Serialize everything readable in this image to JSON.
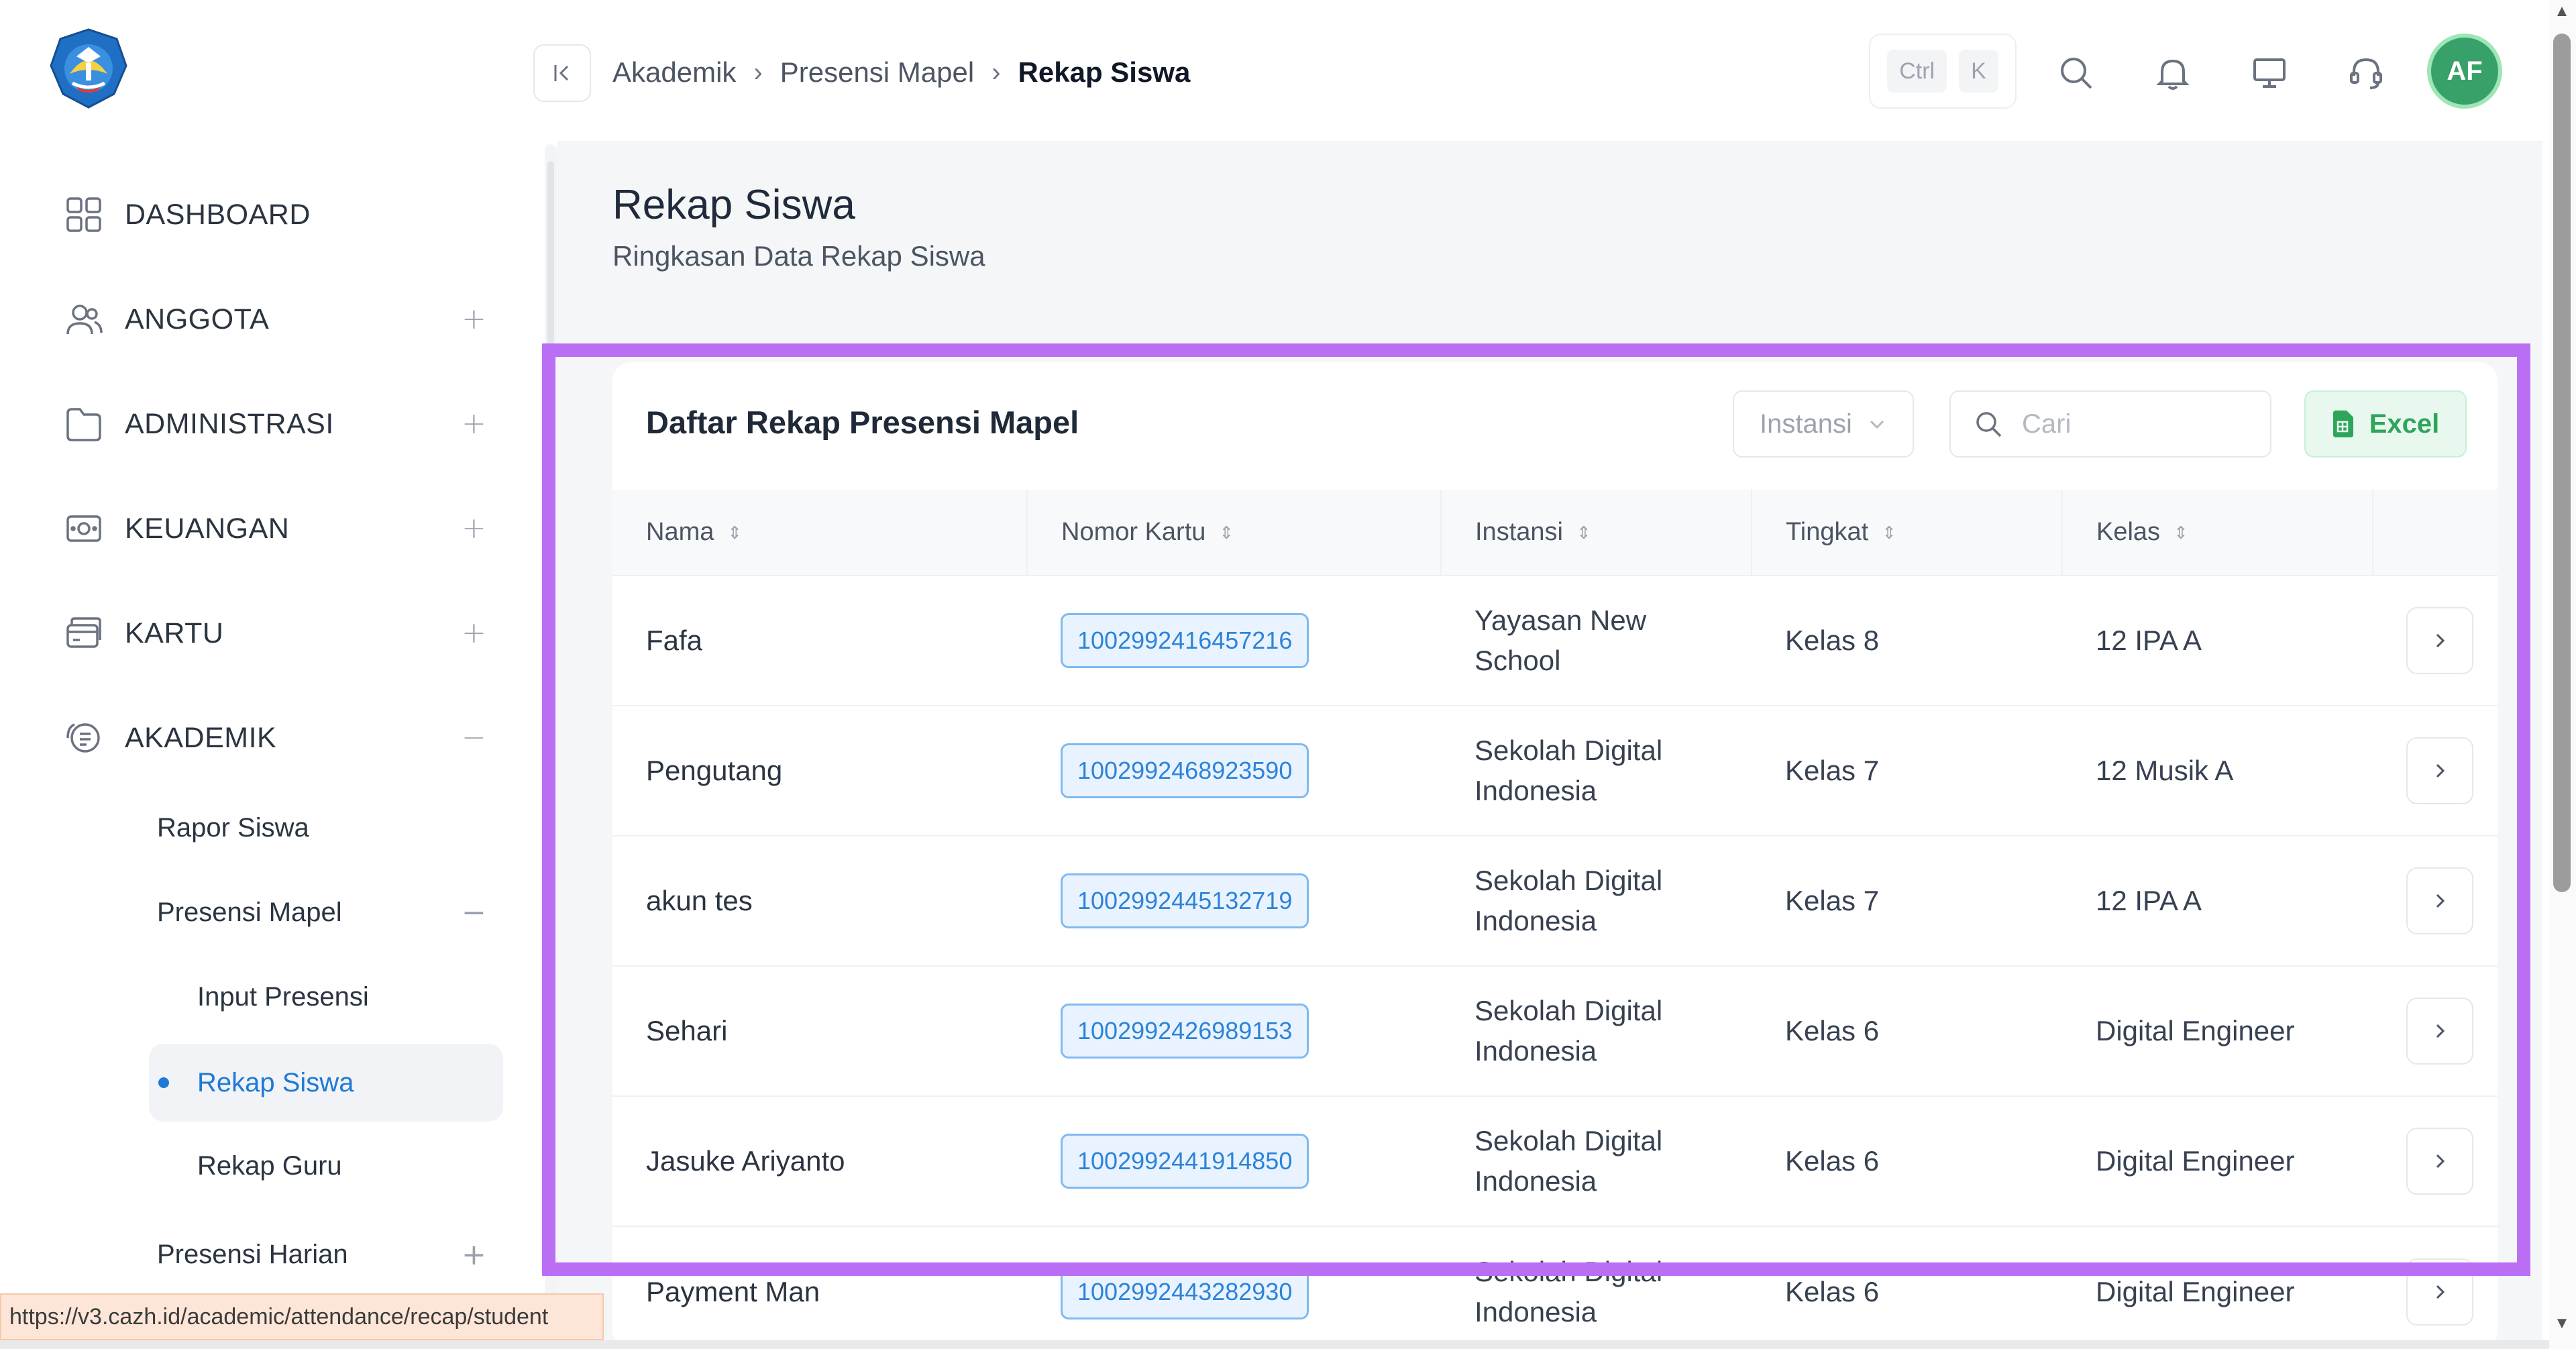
{
  "sidebar": {
    "logo": "tut-wuri-handayani-logo",
    "items": [
      {
        "label": "DASHBOARD",
        "icon": "dashboard-grid-icon",
        "toggle": ""
      },
      {
        "label": "ANGGOTA",
        "icon": "users-icon",
        "toggle": "+"
      },
      {
        "label": "ADMINISTRASI",
        "icon": "folder-icon",
        "toggle": "+"
      },
      {
        "label": "KEUANGAN",
        "icon": "money-icon",
        "toggle": "+"
      },
      {
        "label": "KARTU",
        "icon": "card-icon",
        "toggle": "+"
      },
      {
        "label": "AKADEMIK",
        "icon": "academic-icon",
        "toggle": "−"
      }
    ],
    "sub_items": [
      {
        "label": "Rapor Siswa"
      },
      {
        "label": "Presensi Mapel",
        "toggle": "−"
      },
      {
        "label": "Input Presensi"
      },
      {
        "label": "Rekap Siswa",
        "active": true
      },
      {
        "label": "Rekap Guru"
      },
      {
        "label": "Presensi Harian",
        "toggle": "+"
      }
    ]
  },
  "header": {
    "breadcrumb": [
      "Akademik",
      "Presensi Mapel",
      "Rekap Siswa"
    ],
    "breadcrumb_sep": "›",
    "shortcut": [
      "Ctrl",
      "K"
    ],
    "avatar_initials": "AF"
  },
  "page": {
    "title": "Rekap Siswa",
    "subtitle": "Ringkasan Data Rekap Siswa"
  },
  "card": {
    "title": "Daftar Rekap Presensi Mapel",
    "filter_label": "Instansi",
    "search_placeholder": "Cari",
    "excel_label": "Excel",
    "columns": [
      "Nama",
      "Nomor Kartu",
      "Instansi",
      "Tingkat",
      "Kelas"
    ],
    "rows": [
      {
        "nama": "Fafa",
        "nomor": "1002992416457216",
        "instansi": [
          "Yayasan New",
          "School"
        ],
        "tingkat": "Kelas 8",
        "kelas": "12 IPA A"
      },
      {
        "nama": "Pengutang",
        "nomor": "1002992468923590",
        "instansi": [
          "Sekolah Digital",
          "Indonesia"
        ],
        "tingkat": "Kelas 7",
        "kelas": "12 Musik A"
      },
      {
        "nama": "akun tes",
        "nomor": "1002992445132719",
        "instansi": [
          "Sekolah Digital",
          "Indonesia"
        ],
        "tingkat": "Kelas 7",
        "kelas": "12 IPA A"
      },
      {
        "nama": "Sehari",
        "nomor": "1002992426989153",
        "instansi": [
          "Sekolah Digital",
          "Indonesia"
        ],
        "tingkat": "Kelas 6",
        "kelas": "Digital Engineer"
      },
      {
        "nama": "Jasuke Ariyanto",
        "nomor": "1002992441914850",
        "instansi": [
          "Sekolah Digital",
          "Indonesia"
        ],
        "tingkat": "Kelas 6",
        "kelas": "Digital Engineer"
      },
      {
        "nama": "Payment Man",
        "nomor": "1002992443282930",
        "instansi": [
          "Sekolah Digital",
          "Indonesia"
        ],
        "tingkat": "Kelas 6",
        "kelas": "Digital Engineer"
      }
    ]
  },
  "status_url": "https://v3.cazh.id/academic/attendance/recap/student",
  "colors": {
    "accent": "#1e7ad6",
    "highlight": "#b96ef3",
    "excel": "#2ea55a",
    "avatar": "#38a169"
  }
}
